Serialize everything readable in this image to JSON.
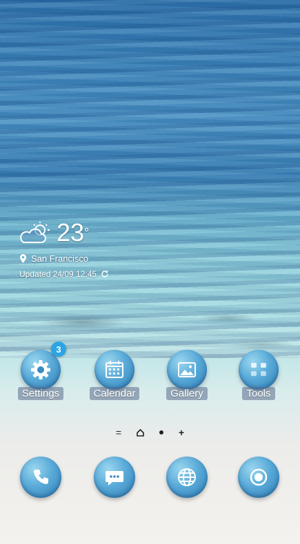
{
  "weather": {
    "temperature": "23",
    "degree": "°",
    "location": "San Francisco",
    "updated": "Updated 24/09 12:45",
    "icon": "partly-cloudy-icon"
  },
  "apps": [
    {
      "label": "Settings",
      "icon": "gear-icon",
      "badge": "3"
    },
    {
      "label": "Calendar",
      "icon": "calendar-icon"
    },
    {
      "label": "Gallery",
      "icon": "image-icon"
    },
    {
      "label": "Tools",
      "icon": "folder-icon"
    }
  ],
  "pager": {
    "menu_glyph": "=",
    "plus_glyph": "+"
  },
  "dock": [
    {
      "icon": "phone-icon"
    },
    {
      "icon": "message-icon"
    },
    {
      "icon": "browser-icon"
    },
    {
      "icon": "camera-icon"
    }
  ],
  "colors": {
    "badge": "#2ba5e4",
    "icon_bubble": "#59aad8"
  }
}
